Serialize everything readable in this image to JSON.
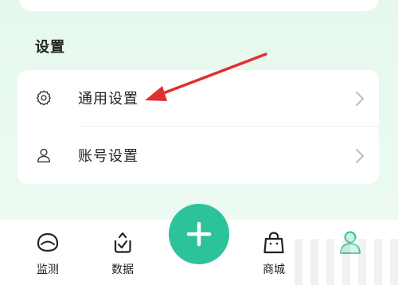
{
  "section": {
    "title": "设置"
  },
  "settings_items": [
    {
      "label": "通用设置",
      "icon": "gear-icon"
    },
    {
      "label": "账号设置",
      "icon": "user-icon"
    }
  ],
  "bottom_nav": {
    "items": [
      {
        "label": "监测",
        "icon": "monitor-icon"
      },
      {
        "label": "数据",
        "icon": "data-icon"
      },
      {
        "label": "商城",
        "icon": "shopping-bag-icon"
      },
      {
        "label": "",
        "icon": "profile-icon",
        "active": true
      }
    ],
    "center_button_icon": "plus-icon"
  },
  "colors": {
    "accent": "#2cc29a",
    "annotation": "#e0302f",
    "background": "#e8f8ef"
  }
}
